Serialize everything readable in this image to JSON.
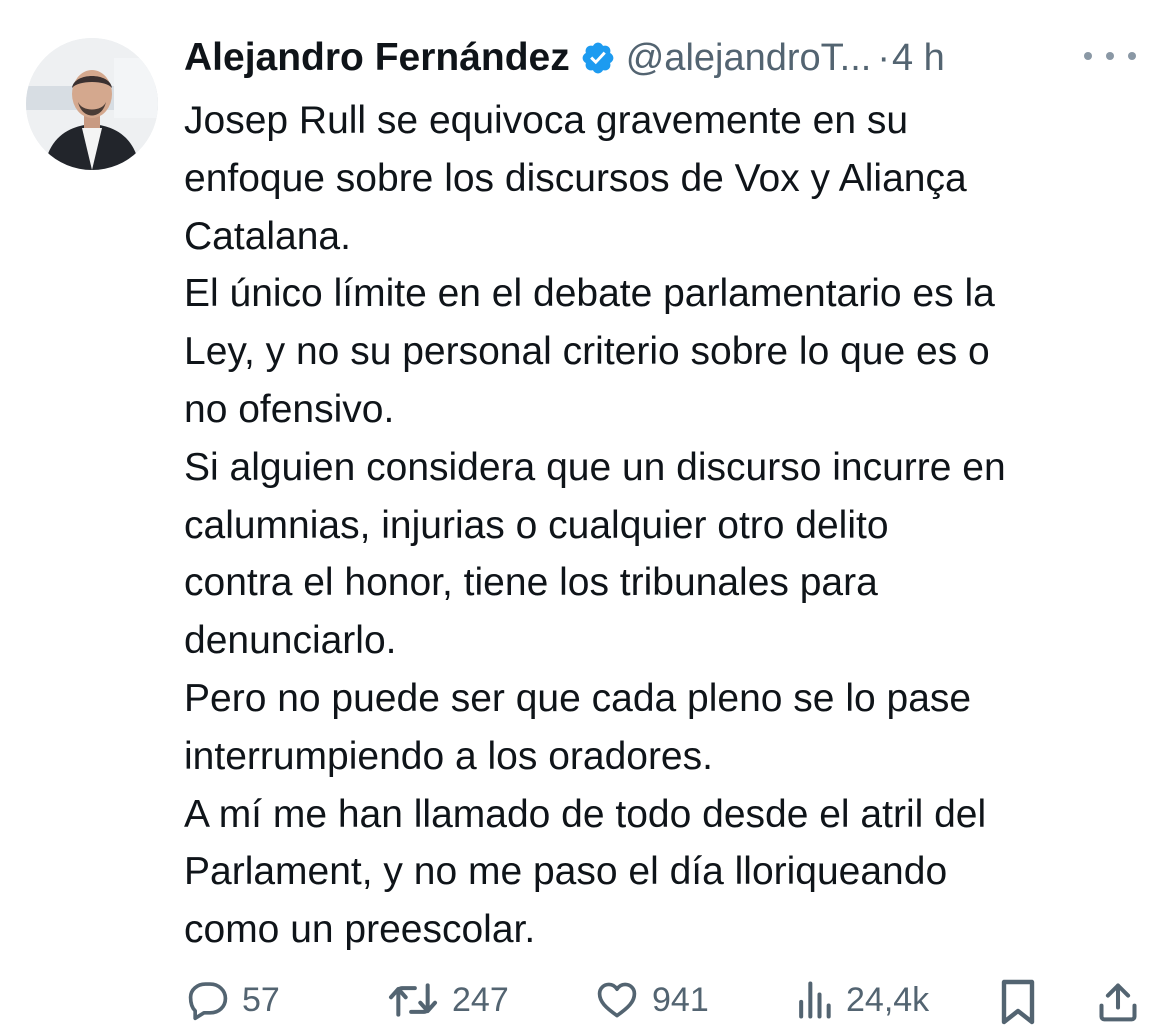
{
  "tweet": {
    "author_name": "Alejandro Fernández",
    "handle": "@alejandroT...",
    "separator": "·",
    "time": "4 h",
    "lines": [
      "Josep Rull se equivoca gravemente en su",
      "enfoque sobre los discursos de Vox y Aliança",
      "Catalana.",
      "El único límite en el debate parlamentario es la",
      "Ley, y no su personal criterio sobre lo que es o",
      "no ofensivo.",
      "Si alguien considera que un discurso incurre en",
      "calumnias, injurias o cualquier otro delito",
      "contra el honor, tiene los tribunales para",
      "denunciarlo.",
      "Pero no puede ser que cada pleno se lo pase",
      "interrumpiendo  a los oradores.",
      "A mí me han llamado de todo desde el atril del",
      "Parlament, y no me paso el día lloriqueando",
      "como un preescolar."
    ]
  },
  "actions": {
    "replies": "57",
    "retweets": "247",
    "likes": "941",
    "views": "24,4k"
  },
  "icons": {
    "verified": "verified-badge-icon",
    "more": "more-icon",
    "reply": "reply-icon",
    "retweet": "retweet-icon",
    "like": "heart-icon",
    "views": "views-icon",
    "bookmark": "bookmark-icon",
    "share": "share-icon"
  },
  "colors": {
    "verified_blue": "#1d9bf0",
    "text": "#0f1419",
    "secondary": "#536471"
  }
}
